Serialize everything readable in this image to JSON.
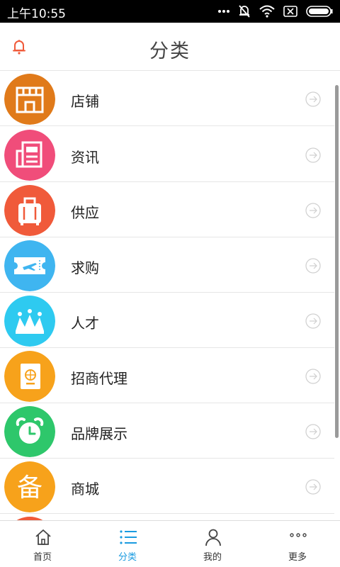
{
  "status_bar": {
    "time": "上午10:55"
  },
  "header": {
    "title": "分类"
  },
  "categories": [
    {
      "label": "店铺",
      "color": "#e07a1a",
      "icon": "storefront-icon"
    },
    {
      "label": "资讯",
      "color": "#f04d7a",
      "icon": "newspaper-icon"
    },
    {
      "label": "供应",
      "color": "#f05a3a",
      "icon": "suitcase-icon"
    },
    {
      "label": "求购",
      "color": "#3fb5f0",
      "icon": "ticket-icon"
    },
    {
      "label": "人才",
      "color": "#2ecaf0",
      "icon": "crown-icon"
    },
    {
      "label": "招商代理",
      "color": "#f7a21b",
      "icon": "passport-icon"
    },
    {
      "label": "品牌展示",
      "color": "#2ec76b",
      "icon": "alarm-clock-icon"
    },
    {
      "label": "商城",
      "color": "#f7a21b",
      "icon": "bei-character-icon",
      "glyph": "备"
    }
  ],
  "bottom_nav": {
    "active": 1,
    "tabs": [
      {
        "label": "首页",
        "icon": "home-icon"
      },
      {
        "label": "分类",
        "icon": "list-icon"
      },
      {
        "label": "我的",
        "icon": "user-icon"
      },
      {
        "label": "更多",
        "icon": "more-dots-icon"
      }
    ]
  },
  "colors": {
    "active_tab": "#1a9be0",
    "bell": "#f05a3a"
  }
}
